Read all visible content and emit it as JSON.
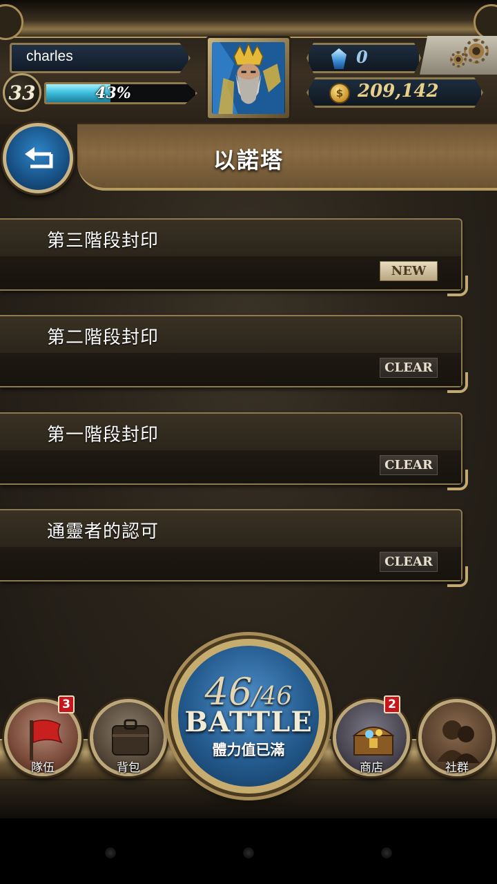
{
  "player": {
    "name": "charles",
    "level": "33",
    "exp_percent_label": "43%",
    "exp_fraction": 0.43
  },
  "currency": {
    "gems": "0",
    "coins": "209,142"
  },
  "header": {
    "title": "以諾塔"
  },
  "stages": [
    {
      "name": "第三階段封印",
      "status": "NEW"
    },
    {
      "name": "第二階段封印",
      "status": "CLEAR"
    },
    {
      "name": "第一階段封印",
      "status": "CLEAR"
    },
    {
      "name": "通靈者的認可",
      "status": "CLEAR"
    }
  ],
  "nav": {
    "team": {
      "label": "隊伍",
      "badge": "3"
    },
    "bag": {
      "label": "背包"
    },
    "shop": {
      "label": "商店",
      "badge": "2"
    },
    "social": {
      "label": "社群"
    }
  },
  "battle": {
    "stamina_current": "46",
    "stamina_max": "/46",
    "label": "BATTLE",
    "status": "體力值已滿"
  },
  "colors": {
    "exp_bar": "#3fc1de",
    "battle_blue": "#245b8e",
    "gold_trim": "#c3aa74",
    "badge_red": "#c4161c"
  }
}
